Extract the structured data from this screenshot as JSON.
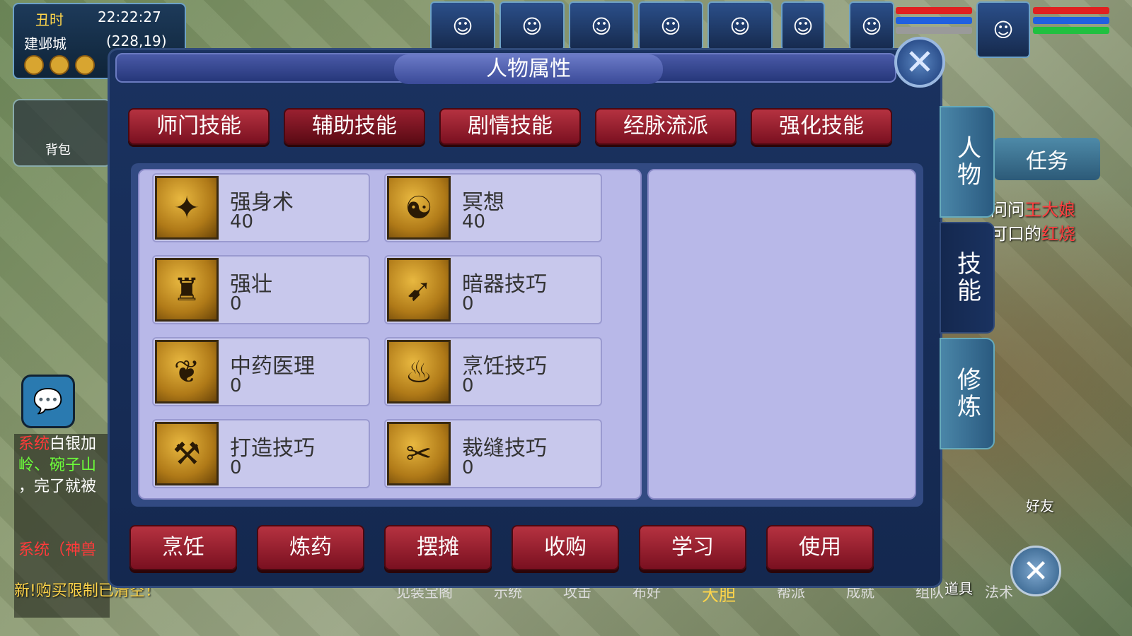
{
  "hud": {
    "time_label": "丑时",
    "clock": "22:22:27",
    "city": "建邺城",
    "coords": "(228,19)",
    "bag_label": "背包"
  },
  "party_portraits": [
    "hero-1",
    "hero-2",
    "beast",
    "girl",
    "hero-3",
    "cat"
  ],
  "panel": {
    "title": "人物属性",
    "tabs": [
      {
        "label": "师门技能",
        "active": false
      },
      {
        "label": "辅助技能",
        "active": true
      },
      {
        "label": "剧情技能",
        "active": false
      },
      {
        "label": "经脉流派",
        "active": false
      },
      {
        "label": "强化技能",
        "active": false
      }
    ],
    "skills": [
      {
        "name": "强身术",
        "level": "40",
        "icon": "strength-icon"
      },
      {
        "name": "冥想",
        "level": "40",
        "icon": "meditation-icon"
      },
      {
        "name": "强壮",
        "level": "0",
        "icon": "muscle-icon"
      },
      {
        "name": "暗器技巧",
        "level": "0",
        "icon": "dart-icon"
      },
      {
        "name": "中药医理",
        "level": "0",
        "icon": "herb-icon"
      },
      {
        "name": "烹饪技巧",
        "level": "0",
        "icon": "cooking-icon"
      },
      {
        "name": "打造技巧",
        "level": "0",
        "icon": "hammer-icon"
      },
      {
        "name": "裁缝技巧",
        "level": "0",
        "icon": "scissors-icon"
      }
    ],
    "buttons": [
      "烹饪",
      "炼药",
      "摆摊",
      "收购",
      "学习",
      "使用"
    ],
    "side_tabs": [
      {
        "label": "人物",
        "active": false
      },
      {
        "label": "技能",
        "active": true
      },
      {
        "label": "修炼",
        "active": false
      }
    ]
  },
  "right": {
    "quest_tab": "任务",
    "quest_line1_a": "问问",
    "quest_line1_b": "王大娘",
    "quest_line2_a": "可口的",
    "quest_line2_b": "红烧",
    "friend_label": "好友",
    "item_label": "道具"
  },
  "chat": {
    "line1_tag": "系统",
    "line1": "白银加",
    "line2": "岭、碗子山",
    "line3": "，完了就被",
    "line4_tag": "系统",
    "line4": "（神兽",
    "line5": "新!购买限制已清空！"
  },
  "bottom_strip": [
    "见装宝阁",
    "示统",
    "攻击",
    "布好",
    "大胆",
    "帮派",
    "成就",
    "组队",
    "法术"
  ]
}
